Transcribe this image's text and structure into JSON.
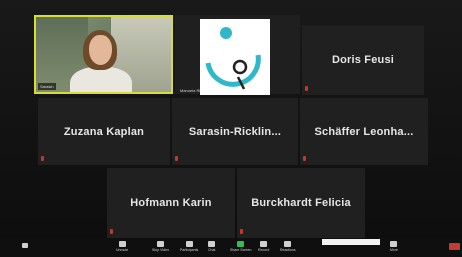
{
  "participants": [
    {
      "name": "Doris Feusi"
    },
    {
      "name": "Zuzana Kaplan"
    },
    {
      "name": "Sarasin-Ricklin..."
    },
    {
      "name": "Schäffer Leonha..."
    },
    {
      "name": "Hofmann Karin"
    },
    {
      "name": "Burckhardt Felicia"
    }
  ],
  "video_tile": {
    "caption": "Sarasin"
  },
  "logo_tile": {
    "caption": "Manuela Ri"
  },
  "toolbar": {
    "items": [
      {
        "label": "Unmute",
        "icon": "microphone-icon"
      },
      {
        "label": "Stop Video",
        "icon": "video-camera-icon"
      },
      {
        "label": "Participants",
        "icon": "participants-icon"
      },
      {
        "label": "Chat",
        "icon": "chat-icon"
      },
      {
        "label": "Share Screen",
        "icon": "share-screen-icon"
      },
      {
        "label": "Record",
        "icon": "record-icon"
      },
      {
        "label": "Reactions",
        "icon": "reactions-icon"
      },
      {
        "label": "More",
        "icon": "more-icon"
      }
    ],
    "leave_label": "End"
  },
  "colors": {
    "active_speaker_border": "#d8dd34",
    "share_green": "#2fbf4f",
    "leave_red": "#c23b34",
    "logo_teal": "#2fb8c9"
  }
}
